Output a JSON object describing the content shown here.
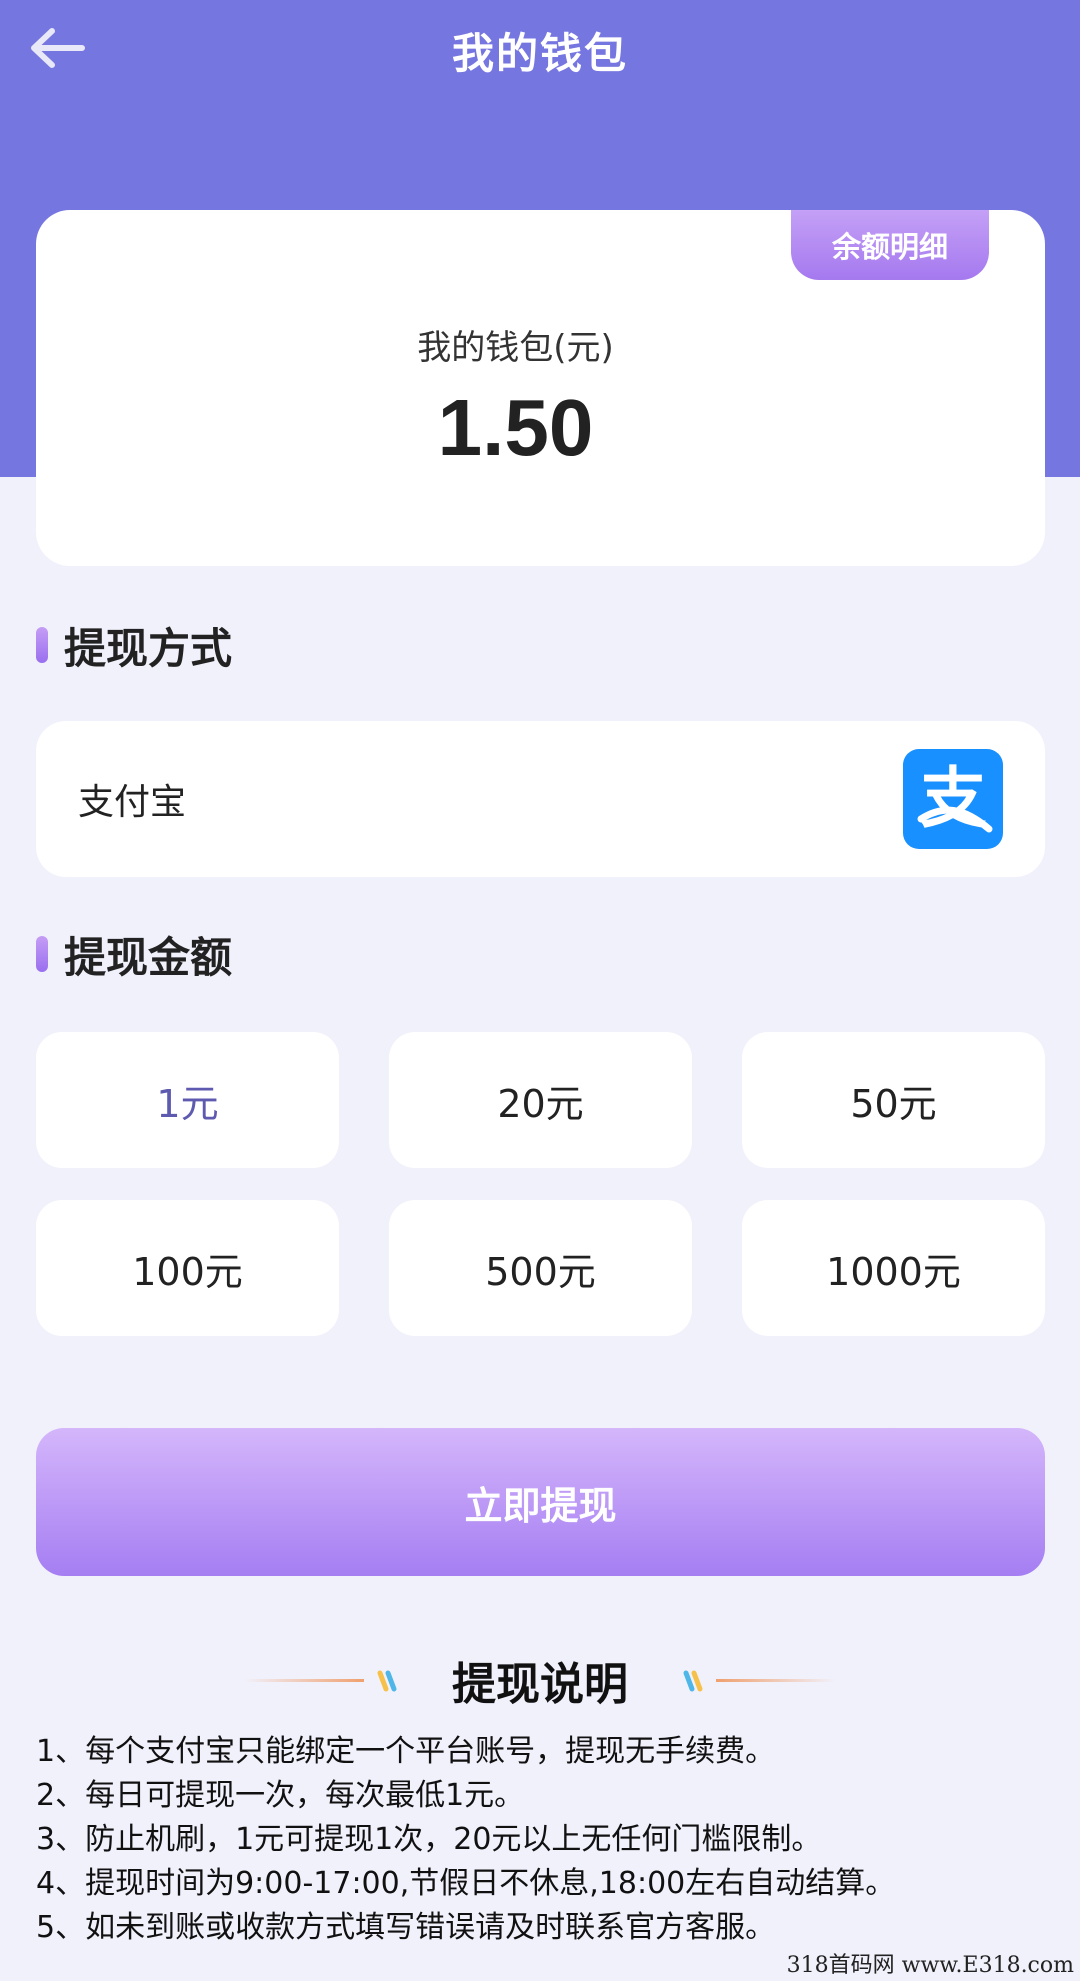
{
  "header": {
    "title": "我的钱包",
    "back_icon": "arrow-left-icon"
  },
  "balance_card": {
    "detail_tab": "余额明细",
    "label": "我的钱包(元)",
    "value": "1.50"
  },
  "withdraw_method": {
    "section_title": "提现方式",
    "selected_label": "支付宝",
    "icon": "alipay-icon",
    "icon_glyph": "支"
  },
  "withdraw_amount": {
    "section_title": "提现金额",
    "options": [
      {
        "label": "1元",
        "selected": true
      },
      {
        "label": "20元",
        "selected": false
      },
      {
        "label": "50元",
        "selected": false
      },
      {
        "label": "100元",
        "selected": false
      },
      {
        "label": "500元",
        "selected": false
      },
      {
        "label": "1000元",
        "selected": false
      }
    ]
  },
  "submit": {
    "label": "立即提现"
  },
  "notes": {
    "title": "提现说明",
    "items": [
      "1、每个支付宝只能绑定一个平台账号，提现无手续费。",
      "2、每日可提现一次，每次最低1元。",
      "3、防止机刷，1元可提现1次，20元以上无任何门槛限制。",
      "4、提现时间为9:00-17:00,节假日不休息,18:00左右自动结算。",
      "5、如未到账或收款方式填写错误请及时联系官方客服。"
    ]
  },
  "watermark": "318首码网 www.E318.com",
  "colors": {
    "header_bg": "#7676e0",
    "page_bg": "#f1f1fc",
    "accent_purple": "#a57ef2",
    "selected_amount": "#5e5aaf",
    "alipay_blue": "#1890ff"
  }
}
